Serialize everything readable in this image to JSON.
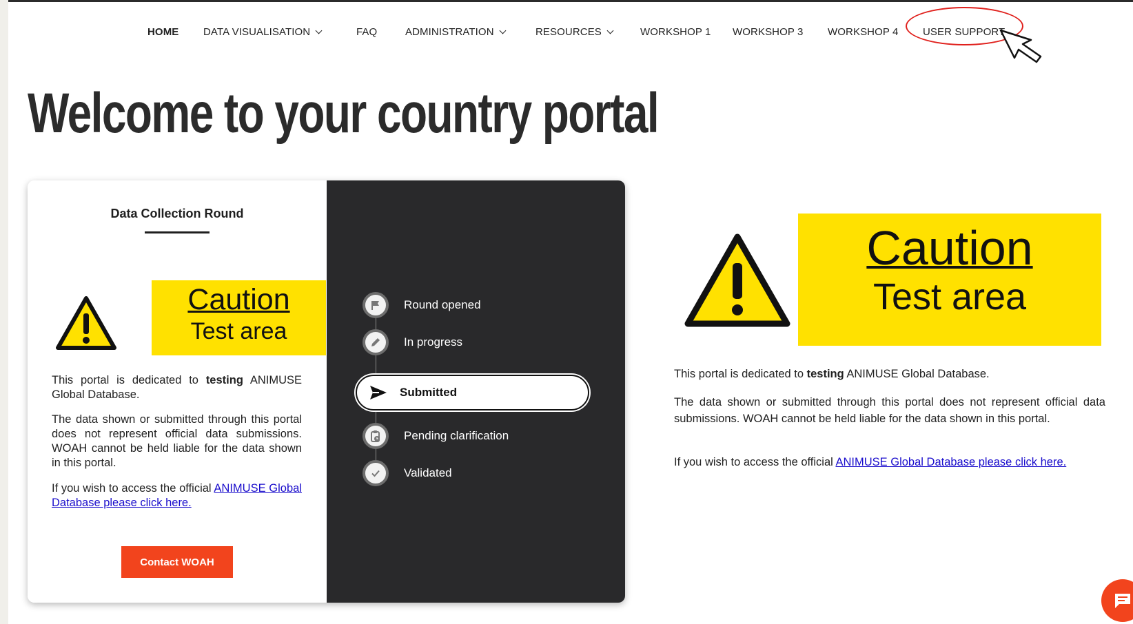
{
  "nav": {
    "items": [
      {
        "label": "HOME",
        "active": true,
        "dropdown": false
      },
      {
        "label": "DATA VISUALISATION",
        "active": false,
        "dropdown": true
      },
      {
        "label": "FAQ",
        "active": false,
        "dropdown": false
      },
      {
        "label": "ADMINISTRATION",
        "active": false,
        "dropdown": true
      },
      {
        "label": "RESOURCES",
        "active": false,
        "dropdown": true
      },
      {
        "label": "WORKSHOP 1",
        "active": false,
        "dropdown": false
      },
      {
        "label": "WORKSHOP 3",
        "active": false,
        "dropdown": false
      },
      {
        "label": "WORKSHOP 4",
        "active": false,
        "dropdown": false
      },
      {
        "label": "USER SUPPORT",
        "active": false,
        "dropdown": false
      }
    ]
  },
  "page": {
    "title": "Welcome to your country portal"
  },
  "card": {
    "title": "Data Collection Round",
    "caution": {
      "title": "Caution",
      "subtitle": "Test area"
    },
    "para1_prefix": "This portal is dedicated to ",
    "para1_bold": "testing",
    "para1_suffix": " ANIMUSE Global Database.",
    "para2": "The data shown or submitted through this portal does not represent official data submissions. WOAH  cannot be held liable for the data shown in this portal.",
    "para3_prefix": "If you wish to access the official ",
    "para3_link": "ANIMUSE Global Database please click here.",
    "contact_button": "Contact WOAH",
    "steps": [
      {
        "label": "Round opened",
        "icon": "flag-icon"
      },
      {
        "label": "In progress",
        "icon": "pencil-icon"
      },
      {
        "label": "Submitted",
        "icon": "send-icon",
        "active": true
      },
      {
        "label": "Pending clarification",
        "icon": "clipboard-clock-icon"
      },
      {
        "label": "Validated",
        "icon": "check-icon"
      }
    ]
  },
  "right": {
    "caution": {
      "title": "Caution",
      "subtitle": "Test area"
    },
    "para1_prefix": "This portal is dedicated to ",
    "para1_bold": "testing",
    "para1_suffix": " ANIMUSE Global Database.",
    "para2": "The data shown or submitted through this portal does not represent official data submissions. WOAH  cannot be held liable for the data shown in this portal.",
    "para3_prefix": "If you wish to access the official ",
    "para3_link": "ANIMUSE Global Database please click here."
  },
  "colors": {
    "accent": "#f2441d",
    "caution_yellow": "#ffe100",
    "dark_panel": "#29292b",
    "link": "#1a0dcc",
    "highlight": "#e0201c"
  }
}
